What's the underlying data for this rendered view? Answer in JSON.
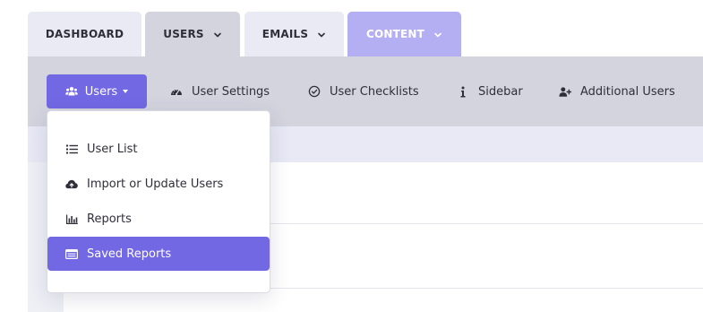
{
  "tabs": [
    {
      "label": "DASHBOARD"
    },
    {
      "label": "USERS"
    },
    {
      "label": "EMAILS"
    },
    {
      "label": "CONTENT"
    }
  ],
  "toolbar": {
    "users_button": "Users",
    "items": [
      {
        "label": "User Settings",
        "icon": "dashboard-gauge-icon"
      },
      {
        "label": "User Checklists",
        "icon": "check-circle-icon"
      },
      {
        "label": "Sidebar",
        "icon": "info-icon"
      },
      {
        "label": "Additional Users",
        "icon": "user-plus-icon"
      }
    ]
  },
  "dropdown": {
    "items": [
      {
        "label": "User List",
        "icon": "list-icon"
      },
      {
        "label": "Import or Update Users",
        "icon": "cloud-upload-icon"
      },
      {
        "label": "Reports",
        "icon": "bar-chart-icon"
      },
      {
        "label": "Saved Reports",
        "icon": "saved-report-icon",
        "active": true
      }
    ]
  },
  "colors": {
    "accent": "#7268e4",
    "tab_content": "#b4aef2",
    "tab_active": "#d3d4de",
    "tab_inactive": "#e9eaf3"
  }
}
